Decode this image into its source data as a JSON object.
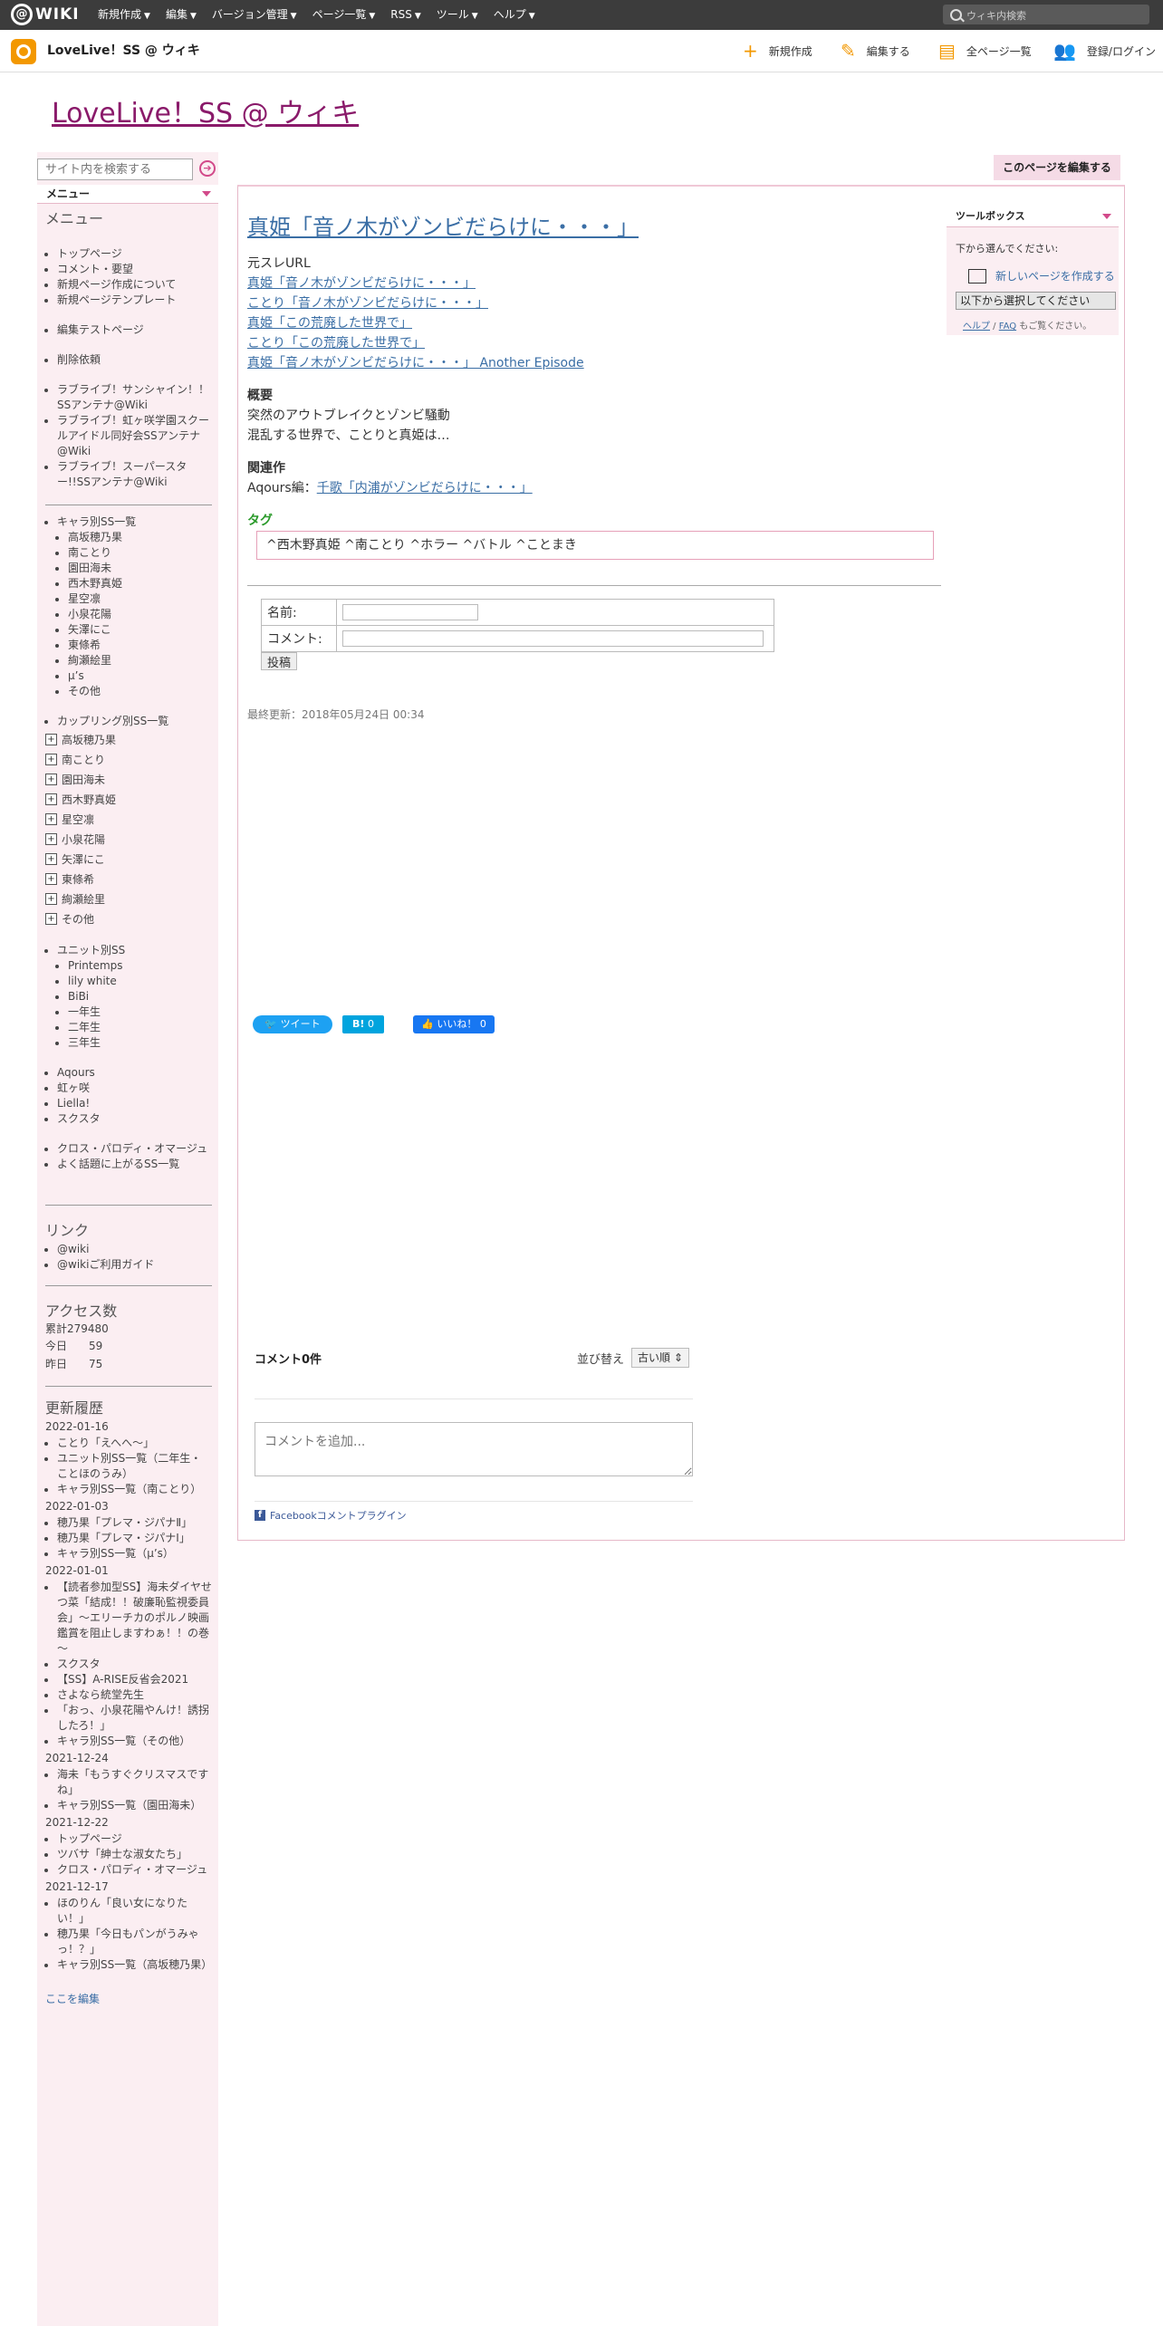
{
  "topbar": {
    "logo_text": "WIKI",
    "nav": [
      "新規作成",
      "編集",
      "バージョン管理",
      "ページ一覧",
      "RSS",
      "ツール",
      "ヘルプ"
    ],
    "search_placeholder": "ウィキ内検索"
  },
  "subbar": {
    "site_name": "LoveLive！SS @ ウィキ",
    "actions": [
      "新規作成",
      "編集する",
      "全ページ一覧",
      "登録/ログイン"
    ]
  },
  "wiki_title": "LoveLive！SS @ ウィキ",
  "sidebar": {
    "search_placeholder": "サイト内を検索する",
    "menu_tab": "メニュー",
    "menu_heading": "メニュー",
    "group1": [
      "トップページ",
      "コメント・要望",
      "新規ページ作成について",
      "新規ページテンプレート"
    ],
    "group2": [
      "編集テストページ"
    ],
    "group3": [
      "削除依頼"
    ],
    "group4": [
      "ラブライブ！サンシャイン！！SSアンテナ@Wiki",
      "ラブライブ！虹ヶ咲学園スクールアイドル同好会SSアンテナ@Wiki",
      "ラブライブ！スーパースター!!SSアンテナ@Wiki"
    ],
    "chara_title": "キャラ別SS一覧",
    "chara": [
      "高坂穂乃果",
      "南ことり",
      "園田海未",
      "西木野真姫",
      "星空凛",
      "小泉花陽",
      "矢澤にこ",
      "東條希",
      "絢瀬絵里",
      "μ’s",
      "その他"
    ],
    "couple_title": "カップリング別SS一覧",
    "couple": [
      "高坂穂乃果",
      "南ことり",
      "園田海未",
      "西木野真姫",
      "星空凛",
      "小泉花陽",
      "矢澤にこ",
      "東條希",
      "絢瀬絵里",
      "その他"
    ],
    "unit_title": "ユニット別SS",
    "unit": [
      "Printemps",
      "lily white",
      "BiBi",
      "一年生",
      "二年生",
      "三年生"
    ],
    "group5": [
      "Aqours",
      "虹ヶ咲",
      "Liella!",
      "スクスタ"
    ],
    "group6": [
      "クロス・パロディ・オマージュ",
      "よく話題に上がるSS一覧"
    ],
    "links_heading": "リンク",
    "links": [
      "@wiki",
      "@wikiご利用ガイド"
    ],
    "access_heading": "アクセス数",
    "access_total": "累計279480",
    "access_today_label": "今日",
    "access_today": "59",
    "access_yest_label": "昨日",
    "access_yest": "75",
    "history_heading": "更新履歴",
    "history": [
      {
        "date": "2022-01-16",
        "items": [
          "ことり「えへへ〜」",
          "ユニット別SS一覧（二年生・ことほのうみ）",
          "キャラ別SS一覧（南ことり）"
        ]
      },
      {
        "date": "2022-01-03",
        "items": [
          "穂乃果「プレマ・ジパナⅡ」",
          "穂乃果「プレマ・ジパナⅠ」",
          "キャラ別SS一覧（μ’s）"
        ]
      },
      {
        "date": "2022-01-01",
        "items": [
          "【読者参加型SS】海未ダイヤせつ菜「結成！！破廉恥監視委員会」～エリーチカのポルノ映画鑑賞を阻止しますわぁ！！の巻～",
          "スクスタ",
          "【SS】A-RISE反省会2021",
          "さよなら統堂先生",
          "「おっ、小泉花陽やんけ！誘拐したろ！」",
          "キャラ別SS一覧（その他）"
        ]
      },
      {
        "date": "2021-12-24",
        "items": [
          "海未「もうすぐクリスマスですね」",
          "キャラ別SS一覧（園田海未）"
        ]
      },
      {
        "date": "2021-12-22",
        "items": [
          "トップページ",
          "ツバサ「紳士な淑女たち」",
          "クロス・パロディ・オマージュ"
        ]
      },
      {
        "date": "2021-12-17",
        "items": [
          "ほのりん「良い女になりたい！」",
          "穂乃果「今日もパンがうみゃっ！？」",
          "キャラ別SS一覧（高坂穂乃果）"
        ]
      }
    ],
    "edit_here": "ここを編集"
  },
  "main": {
    "edit_page_btn": "このページを編集する",
    "page_title": "真姫「音ノ木がゾンビだらけに・・・」",
    "source_label": "元スレURL",
    "source_links": [
      "真姫「音ノ木がゾンビだらけに・・・」",
      "ことり「音ノ木がゾンビだらけに・・・」",
      "真姫「この荒廃した世界で」",
      "ことり「この荒廃した世界で」",
      "真姫「音ノ木がゾンビだらけに・・・」 Another Episode"
    ],
    "summary_heading": "概要",
    "summary_lines": [
      "突然のアウトブレイクとゾンビ騒動",
      "混乱する世界で、ことりと真姫は…"
    ],
    "related_heading": "関連作",
    "related_prefix": "Aqours編：",
    "related_link": "千歌「内浦がゾンビだらけに・・・」",
    "tag_heading": "タグ",
    "tags": "^西木野真姫 ^南ことり ^ホラー ^バトル ^ことまき",
    "form_name_label": "名前:",
    "form_comment_label": "コメント:",
    "post_btn": "投稿",
    "last_updated": "最終更新：2018年05月24日 00:34"
  },
  "social": {
    "tweet": "ツイート",
    "hatena": "B!",
    "hatena_count": "0",
    "like": "いいね！",
    "like_count": "0"
  },
  "comments": {
    "count": "コメント0件",
    "sort_label": "並び替え",
    "sort_value": "古い順",
    "placeholder": "コメントを追加...",
    "fb_plugin": "Facebookコメントプラグイン"
  },
  "toolbox": {
    "title": "ツールボックス",
    "message": "下から選んでください:",
    "new_page": "新しいページを作成する",
    "select": "以下から選択してください",
    "help": "ヘルプ",
    "faq": "FAQ",
    "help_suffix": "もご覧ください。"
  }
}
